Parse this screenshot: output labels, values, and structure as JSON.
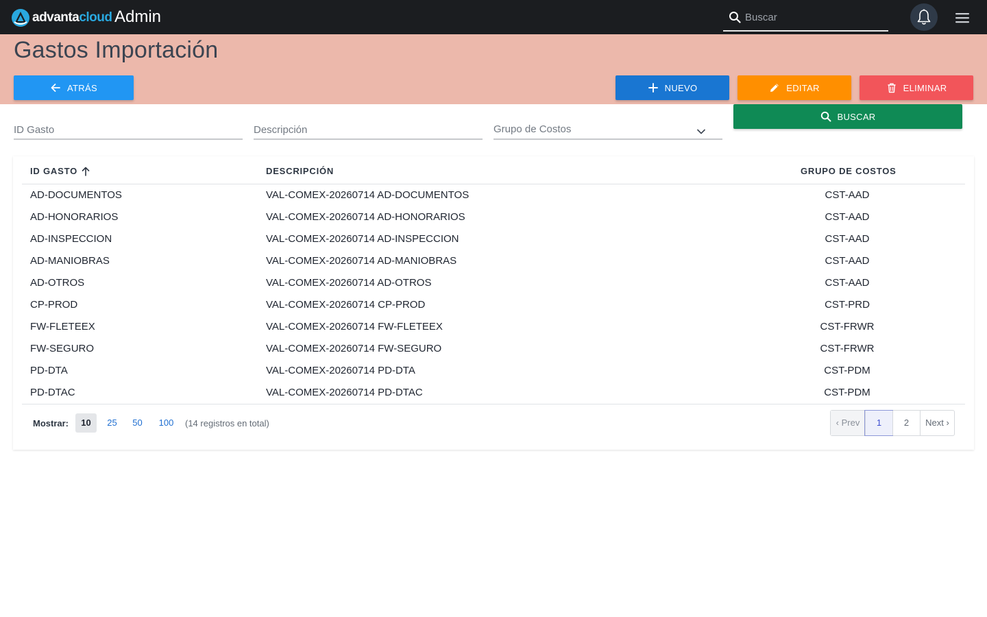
{
  "brand": {
    "logo_word_light": "advanta",
    "logo_word_accent": "cloud",
    "app_section": "Admin"
  },
  "topbar": {
    "search_placeholder": "Buscar"
  },
  "page": {
    "title": "Gastos Importación"
  },
  "actions": {
    "back": "ATRÁS",
    "new": "NUEVO",
    "edit": "EDITAR",
    "delete": "ELIMINAR",
    "search": "BUSCAR"
  },
  "filters": {
    "id_placeholder": "ID Gasto",
    "description_placeholder": "Descripción",
    "group_label": "Grupo de Costos"
  },
  "table": {
    "columns": {
      "id": "ID GASTO",
      "description": "DESCRIPCIÓN",
      "group": "GRUPO DE COSTOS"
    },
    "rows": [
      {
        "id": "AD-DOCUMENTOS",
        "description": "VAL-COMEX-20260714 AD-DOCUMENTOS",
        "group": "CST-AAD"
      },
      {
        "id": "AD-HONORARIOS",
        "description": "VAL-COMEX-20260714 AD-HONORARIOS",
        "group": "CST-AAD"
      },
      {
        "id": "AD-INSPECCION",
        "description": "VAL-COMEX-20260714 AD-INSPECCION",
        "group": "CST-AAD"
      },
      {
        "id": "AD-MANIOBRAS",
        "description": "VAL-COMEX-20260714 AD-MANIOBRAS",
        "group": "CST-AAD"
      },
      {
        "id": "AD-OTROS",
        "description": "VAL-COMEX-20260714 AD-OTROS",
        "group": "CST-AAD"
      },
      {
        "id": "CP-PROD",
        "description": "VAL-COMEX-20260714 CP-PROD",
        "group": "CST-PRD"
      },
      {
        "id": "FW-FLETEEX",
        "description": "VAL-COMEX-20260714 FW-FLETEEX",
        "group": "CST-FRWR"
      },
      {
        "id": "FW-SEGURO",
        "description": "VAL-COMEX-20260714 FW-SEGURO",
        "group": "CST-FRWR"
      },
      {
        "id": "PD-DTA",
        "description": "VAL-COMEX-20260714 PD-DTA",
        "group": "CST-PDM"
      },
      {
        "id": "PD-DTAC",
        "description": "VAL-COMEX-20260714 PD-DTAC",
        "group": "CST-PDM"
      }
    ]
  },
  "footer": {
    "show_label": "Mostrar:",
    "page_sizes": [
      "10",
      "25",
      "50",
      "100"
    ],
    "active_page_size": "10",
    "total_text": "(14 registros en total)",
    "pagination": {
      "prev": "‹ Prev",
      "pages": [
        "1",
        "2"
      ],
      "current": "1",
      "next": "Next ›"
    }
  },
  "colors": {
    "topbar": "#1b1d20",
    "header_band": "#ecb8ab",
    "back_button": "#2196f3",
    "new_button": "#1976d2",
    "edit_button": "#ff8f00",
    "delete_button": "#f2555a",
    "search_button": "#0f8a55",
    "logo_accent": "#29a8df"
  },
  "icons": {
    "search": "search-icon",
    "bell": "bell-icon",
    "menu": "hamburger-menu-icon",
    "back": "arrow-left-icon",
    "new": "plus-icon",
    "edit": "pencil-icon",
    "delete": "trash-icon",
    "dropdown": "chevron-down-icon",
    "sort": "arrow-up-icon"
  }
}
